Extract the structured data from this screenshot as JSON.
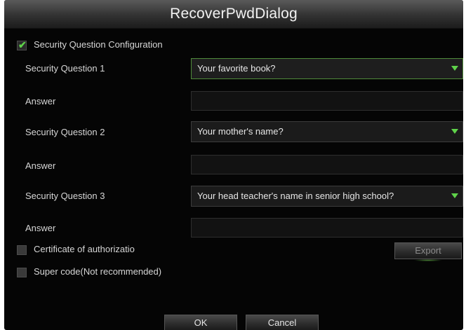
{
  "dialog": {
    "title": "RecoverPwdDialog"
  },
  "security_config": {
    "label": "Security Question Configuration",
    "checked": true
  },
  "questions": [
    {
      "label": "Security Question 1",
      "selected": "Your favorite book?",
      "answer_label": "Answer",
      "answer_value": ""
    },
    {
      "label": "Security Question 2",
      "selected": "Your mother's name?",
      "answer_label": "Answer",
      "answer_value": ""
    },
    {
      "label": "Security Question 3",
      "selected": "Your head teacher's name in senior high school?",
      "answer_label": "Answer",
      "answer_value": ""
    }
  ],
  "certificate": {
    "label": "Certificate of authorizatio",
    "checked": false,
    "export_label": "Export"
  },
  "super_code": {
    "label": "Super code(Not recommended)",
    "checked": false
  },
  "footer": {
    "ok_label": "OK",
    "cancel_label": "Cancel"
  },
  "colors": {
    "accent": "#5fd34a",
    "background": "#050505",
    "text": "#d6d6d6"
  }
}
